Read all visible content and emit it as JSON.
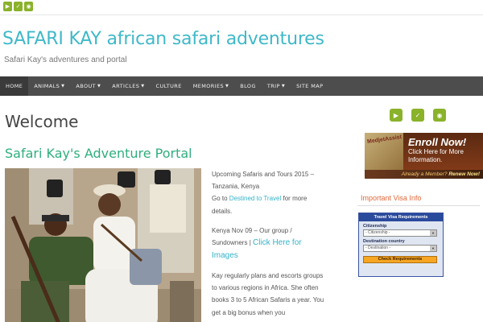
{
  "topbar": {
    "icons": [
      "youtube-icon",
      "twitter-icon",
      "rss-icon"
    ]
  },
  "header": {
    "title": "SAFARI KAY african safari adventures",
    "description": "Safari Kay's adventures and portal"
  },
  "nav": {
    "items": [
      {
        "label": "HOME"
      },
      {
        "label": "ANIMALS",
        "caret": "▼"
      },
      {
        "label": "ABOUT",
        "caret": "▼"
      },
      {
        "label": "ARTICLES",
        "caret": "▼"
      },
      {
        "label": "CULTURE"
      },
      {
        "label": "MEMORIES",
        "caret": "▼"
      },
      {
        "label": "BLOG"
      },
      {
        "label": "TRIP",
        "caret": "▼"
      },
      {
        "label": "SITE MAP"
      }
    ]
  },
  "main": {
    "page_title": "Welcome",
    "post_title": "Safari Kay's Adventure Portal",
    "text": {
      "p1": "Upcoming Safaris and Tours 2015 – Tanzania, Kenya",
      "p1b_prefix": "Go to ",
      "p1b_link": "Destined to Travel",
      "p1b_suffix": " for more details.",
      "p2": "Kenya Nov 09 – Our group / Sundowners |",
      "p2_link": "Click Here for Images",
      "p3": "Kay regularly plans and escorts groups to various regions in Africa. She often books 3 to 5 African Safaris a year. You get a big bonus when you"
    }
  },
  "aside": {
    "icons": [
      "youtube-icon",
      "twitter-icon",
      "rss-icon"
    ],
    "banner": {
      "logo": "MedjetAssist",
      "enroll": "Enroll Now!",
      "click": "Click Here for More Information.",
      "member": "Already a Member?",
      "renew": "Renew Now!"
    },
    "visa_title": "Important Visa Info",
    "visa_widget": {
      "head": "Travel Visa Requirements",
      "citizenship_label": "Citizenship",
      "citizenship_value": "- Citizenship -",
      "destination_label": "Destination country",
      "destination_value": "- Destination -",
      "button": "Check Requirements"
    }
  },
  "colors": {
    "accent": "#3fb8c9",
    "green": "#8ab22a",
    "post_title": "#2fae7d",
    "nav_bg": "#4d4d4d"
  }
}
